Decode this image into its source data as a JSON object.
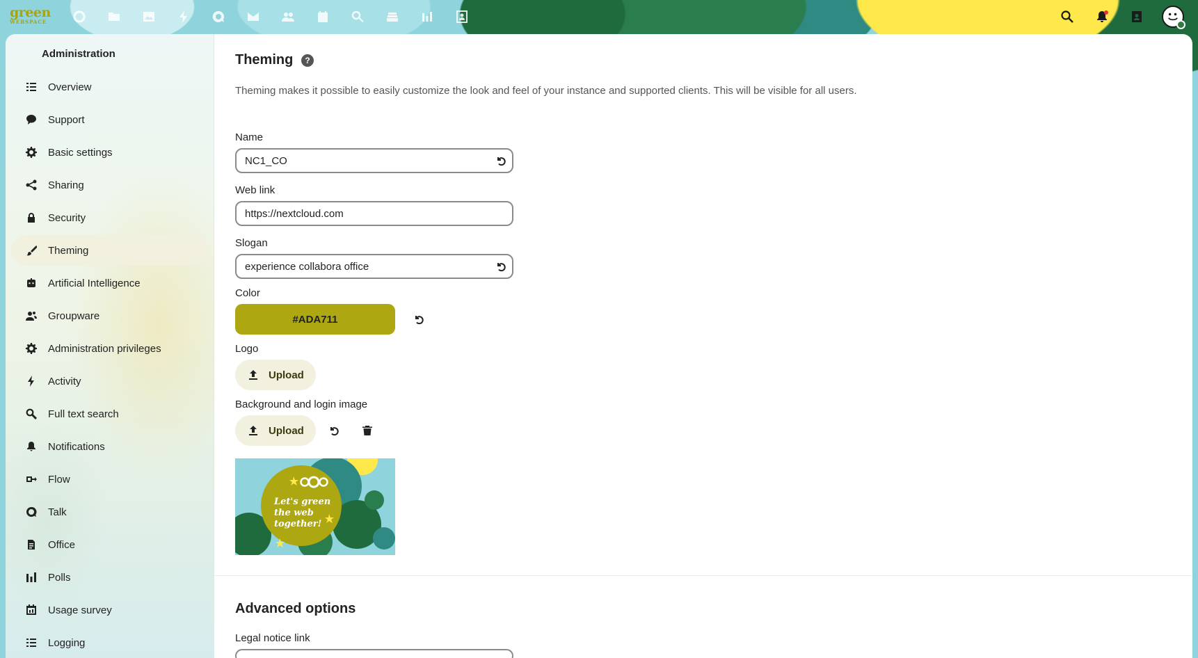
{
  "brand": {
    "line1": "green",
    "line2": "WEBSPACE"
  },
  "top_apps": [
    "dashboard-icon",
    "files-icon",
    "photos-icon",
    "activity-icon",
    "talk-icon",
    "mail-icon",
    "contacts-icon",
    "calendar-icon",
    "search-app-icon",
    "deck-icon",
    "analytics-icon",
    "profile-icon"
  ],
  "sidebar": {
    "title": "Administration",
    "items": [
      {
        "label": "Overview"
      },
      {
        "label": "Support"
      },
      {
        "label": "Basic settings"
      },
      {
        "label": "Sharing"
      },
      {
        "label": "Security"
      },
      {
        "label": "Theming",
        "active": true
      },
      {
        "label": "Artificial Intelligence"
      },
      {
        "label": "Groupware"
      },
      {
        "label": "Administration privileges"
      },
      {
        "label": "Activity"
      },
      {
        "label": "Full text search"
      },
      {
        "label": "Notifications"
      },
      {
        "label": "Flow"
      },
      {
        "label": "Talk"
      },
      {
        "label": "Office"
      },
      {
        "label": "Polls"
      },
      {
        "label": "Usage survey"
      },
      {
        "label": "Logging"
      }
    ]
  },
  "theming": {
    "title": "Theming",
    "help": "?",
    "description": "Theming makes it possible to easily customize the look and feel of your instance and supported clients. This will be visible for all users.",
    "name_label": "Name",
    "name_value": "NC1_CO",
    "weblink_label": "Web link",
    "weblink_value": "https://nextcloud.com",
    "slogan_label": "Slogan",
    "slogan_value": "experience collabora office",
    "color_label": "Color",
    "color_value": "#ADA711",
    "logo_label": "Logo",
    "upload_label": "Upload",
    "background_label": "Background and login image",
    "preview_text": [
      "Let's green",
      "the web",
      "together!"
    ]
  },
  "advanced": {
    "title": "Advanced options",
    "legal_label": "Legal notice link"
  },
  "colors": {
    "accent": "#ADA711",
    "active_bg": "#f2f1df"
  }
}
